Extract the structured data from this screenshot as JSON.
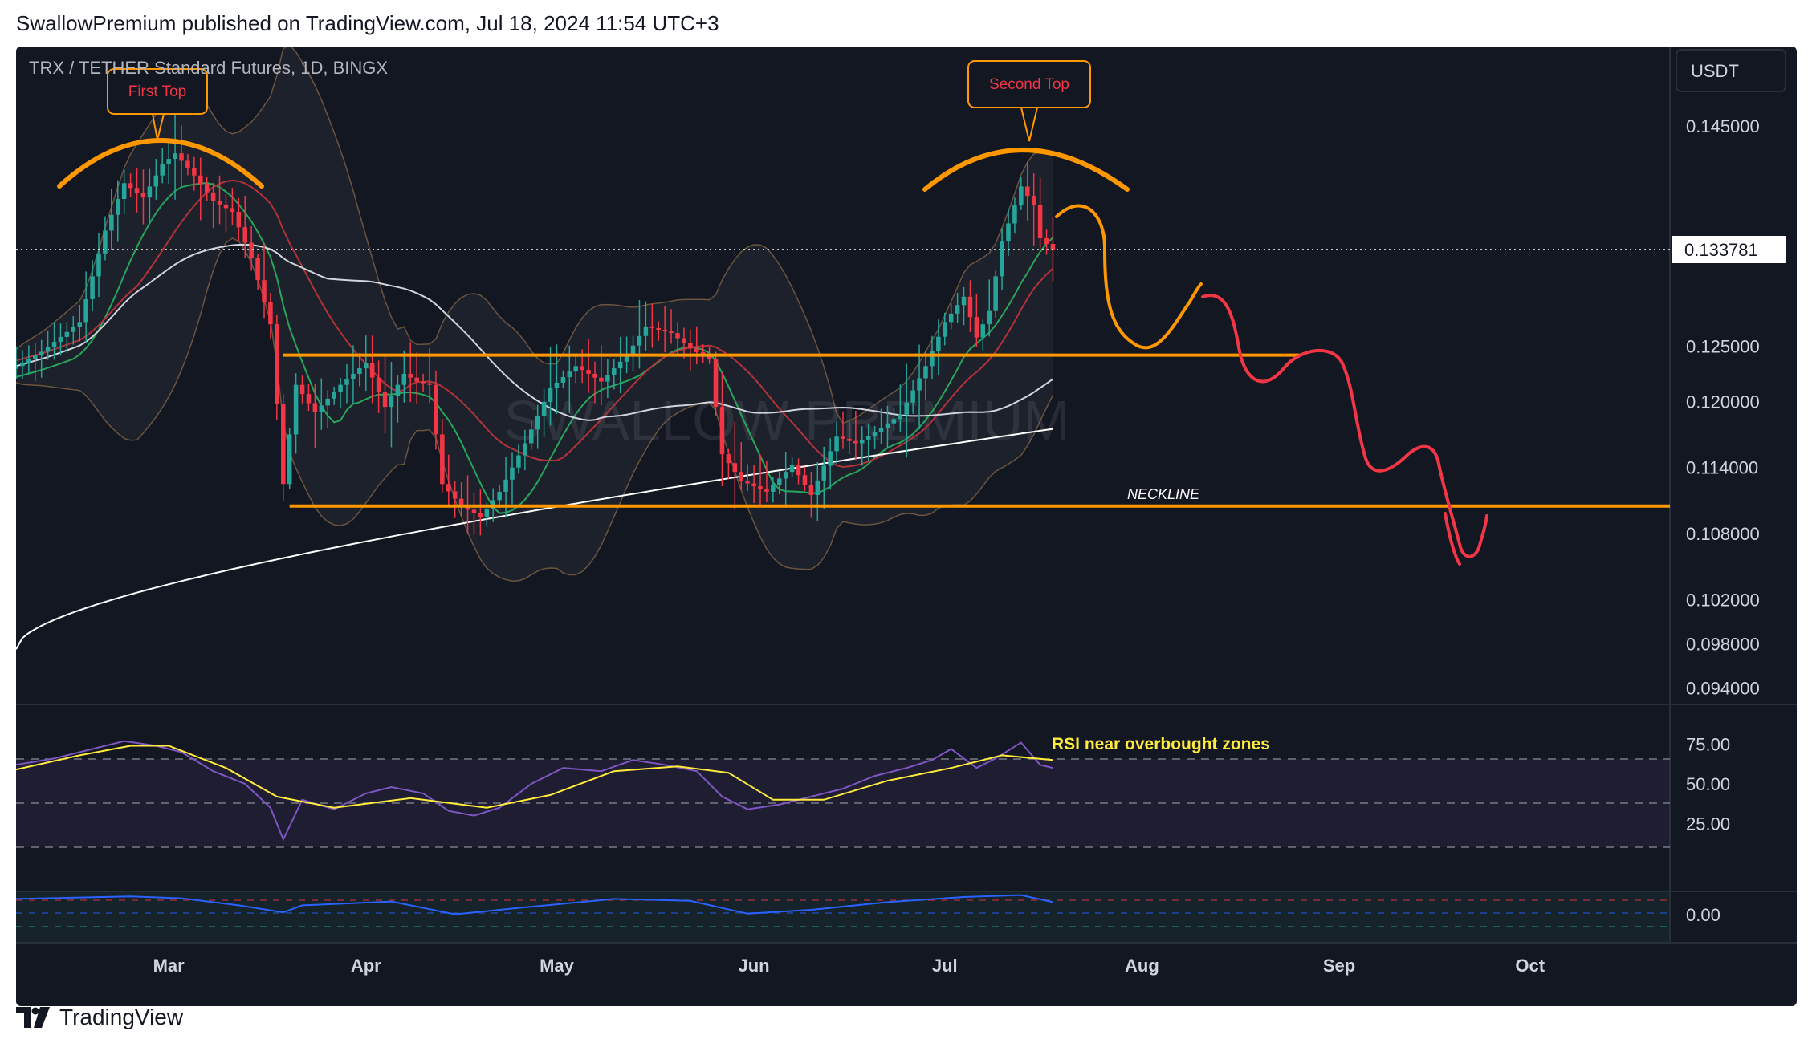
{
  "header": {
    "publish_line": "SwallowPremium published on TradingView.com, Jul 18, 2024 11:54 UTC+3"
  },
  "symbol_line": "TRX / TETHER Standard Futures, 1D, BINGX",
  "currency_button": "USDT",
  "watermark": "SWALLOW PREMIUM",
  "annotations": {
    "first_top": "First Top",
    "second_top": "Second Top",
    "neckline": "NECKLINE",
    "rsi_note": "RSI near overbought zones"
  },
  "footer": {
    "brand": "TradingView"
  },
  "colors": {
    "background": "#131722",
    "up": "#26a69a",
    "down": "#f23645",
    "annotation_orange": "#ff9800",
    "projection_red": "#f23645",
    "rsi_line": "#7e57c2",
    "rsi_ma": "#ffeb3b",
    "osc_line": "#2962ff"
  },
  "chart_data": [
    {
      "type": "candlestick",
      "title": "TRX / TETHER Standard Futures, 1D, BINGX",
      "x_ticks": [
        "Mar",
        "Apr",
        "May",
        "Jun",
        "Jul",
        "Aug",
        "Sep",
        "Oct"
      ],
      "x_tick_dates": [
        "2024-03-01",
        "2024-04-01",
        "2024-05-01",
        "2024-06-01",
        "2024-07-01",
        "2024-08-01",
        "2024-09-01",
        "2024-10-01"
      ],
      "x_range": [
        "2024-02-06",
        "2024-10-23"
      ],
      "y_ticks": [
        0.145,
        0.125,
        0.12,
        0.114,
        0.108,
        0.102,
        0.098,
        0.094
      ],
      "y_tick_labels": [
        "0.145000",
        "0.125000",
        "0.120000",
        "0.114000",
        "0.108000",
        "0.102000",
        "0.098000",
        "0.094000"
      ],
      "ylim": [
        0.0925,
        0.1522
      ],
      "current_price": 0.133781,
      "current_price_label": "0.133781",
      "support_resistance": [
        {
          "name": "resistance",
          "value": 0.1242,
          "from": "2024-03-19",
          "to": "2024-08-26"
        },
        {
          "name": "neckline",
          "value": 0.1105,
          "from": "2024-03-20",
          "to": "2024-10-23"
        }
      ],
      "anchors": [
        {
          "date": "2024-02-06",
          "close": 0.1232
        },
        {
          "date": "2024-02-10",
          "close": 0.1245
        },
        {
          "date": "2024-02-16",
          "close": 0.1272
        },
        {
          "date": "2024-02-20",
          "close": 0.1355
        },
        {
          "date": "2024-02-23",
          "close": 0.1398
        },
        {
          "date": "2024-02-26",
          "close": 0.1385
        },
        {
          "date": "2024-02-29",
          "close": 0.1415
        },
        {
          "date": "2024-03-02",
          "close": 0.1425
        },
        {
          "date": "2024-03-05",
          "close": 0.1405
        },
        {
          "date": "2024-03-08",
          "close": 0.1382
        },
        {
          "date": "2024-03-11",
          "close": 0.1372
        },
        {
          "date": "2024-03-14",
          "close": 0.133
        },
        {
          "date": "2024-03-17",
          "close": 0.127
        },
        {
          "date": "2024-03-19",
          "close": 0.1125
        },
        {
          "date": "2024-03-21",
          "close": 0.1215
        },
        {
          "date": "2024-03-24",
          "close": 0.119
        },
        {
          "date": "2024-03-28",
          "close": 0.1215
        },
        {
          "date": "2024-04-01",
          "close": 0.1235
        },
        {
          "date": "2024-04-04",
          "close": 0.1195
        },
        {
          "date": "2024-04-07",
          "close": 0.1225
        },
        {
          "date": "2024-04-09",
          "close": 0.1218
        },
        {
          "date": "2024-04-11",
          "close": 0.1215
        },
        {
          "date": "2024-04-13",
          "close": 0.1125
        },
        {
          "date": "2024-04-16",
          "close": 0.1105
        },
        {
          "date": "2024-04-19",
          "close": 0.1095
        },
        {
          "date": "2024-04-22",
          "close": 0.1118
        },
        {
          "date": "2024-04-26",
          "close": 0.1162
        },
        {
          "date": "2024-04-30",
          "close": 0.1212
        },
        {
          "date": "2024-05-04",
          "close": 0.1232
        },
        {
          "date": "2024-05-08",
          "close": 0.1218
        },
        {
          "date": "2024-05-12",
          "close": 0.1242
        },
        {
          "date": "2024-05-15",
          "close": 0.1268
        },
        {
          "date": "2024-05-19",
          "close": 0.1262
        },
        {
          "date": "2024-05-22",
          "close": 0.1248
        },
        {
          "date": "2024-05-25",
          "close": 0.1238
        },
        {
          "date": "2024-05-27",
          "close": 0.1152
        },
        {
          "date": "2024-05-30",
          "close": 0.1128
        },
        {
          "date": "2024-06-03",
          "close": 0.1118
        },
        {
          "date": "2024-06-07",
          "close": 0.1142
        },
        {
          "date": "2024-06-10",
          "close": 0.1115
        },
        {
          "date": "2024-06-14",
          "close": 0.1168
        },
        {
          "date": "2024-06-17",
          "close": 0.1162
        },
        {
          "date": "2024-06-20",
          "close": 0.1172
        },
        {
          "date": "2024-06-24",
          "close": 0.1188
        },
        {
          "date": "2024-06-28",
          "close": 0.1232
        },
        {
          "date": "2024-07-01",
          "close": 0.1272
        },
        {
          "date": "2024-07-04",
          "close": 0.1295
        },
        {
          "date": "2024-07-06",
          "close": 0.1258
        },
        {
          "date": "2024-07-08",
          "close": 0.1282
        },
        {
          "date": "2024-07-10",
          "close": 0.1345
        },
        {
          "date": "2024-07-12",
          "close": 0.1378
        },
        {
          "date": "2024-07-13",
          "close": 0.1395
        },
        {
          "date": "2024-07-15",
          "close": 0.1378
        },
        {
          "date": "2024-07-16",
          "close": 0.1348
        },
        {
          "date": "2024-07-18",
          "close": 0.133781
        }
      ]
    },
    {
      "type": "line",
      "title": "RSI",
      "y_ticks": [
        75,
        50,
        25
      ],
      "y_tick_labels": [
        "75.00",
        "50.00",
        "25.00"
      ],
      "ylim": [
        0,
        100
      ],
      "bands": [
        70,
        50,
        30
      ],
      "series": [
        {
          "values": [
            [
              "2024-02-06",
              62
            ],
            [
              "2024-02-12",
              66
            ],
            [
              "2024-02-18",
              72
            ],
            [
              "2024-02-23",
              77
            ],
            [
              "2024-02-28",
              74
            ],
            [
              "2024-03-03",
              70
            ],
            [
              "2024-03-08",
              58
            ],
            [
              "2024-03-13",
              50
            ],
            [
              "2024-03-17",
              35
            ],
            [
              "2024-03-19",
              15
            ],
            [
              "2024-03-22",
              40
            ],
            [
              "2024-03-27",
              34
            ],
            [
              "2024-04-01",
              44
            ],
            [
              "2024-04-05",
              48
            ],
            [
              "2024-04-10",
              44
            ],
            [
              "2024-04-14",
              33
            ],
            [
              "2024-04-18",
              30
            ],
            [
              "2024-04-22",
              35
            ],
            [
              "2024-04-27",
              50
            ],
            [
              "2024-05-02",
              60
            ],
            [
              "2024-05-08",
              58
            ],
            [
              "2024-05-13",
              65
            ],
            [
              "2024-05-18",
              62
            ],
            [
              "2024-05-23",
              58
            ],
            [
              "2024-05-27",
              42
            ],
            [
              "2024-05-31",
              34
            ],
            [
              "2024-06-05",
              37
            ],
            [
              "2024-06-10",
              42
            ],
            [
              "2024-06-15",
              47
            ],
            [
              "2024-06-20",
              55
            ],
            [
              "2024-06-25",
              60
            ],
            [
              "2024-06-29",
              65
            ],
            [
              "2024-07-02",
              72
            ],
            [
              "2024-07-06",
              60
            ],
            [
              "2024-07-09",
              66
            ],
            [
              "2024-07-13",
              76
            ],
            [
              "2024-07-16",
              62
            ],
            [
              "2024-07-18",
              60
            ]
          ]
        },
        {
          "values": [
            [
              "2024-02-06",
              59
            ],
            [
              "2024-02-16",
              68
            ],
            [
              "2024-02-24",
              74
            ],
            [
              "2024-03-01",
              74
            ],
            [
              "2024-03-10",
              60
            ],
            [
              "2024-03-18",
              42
            ],
            [
              "2024-03-27",
              35
            ],
            [
              "2024-04-08",
              41
            ],
            [
              "2024-04-20",
              35
            ],
            [
              "2024-04-30",
              43
            ],
            [
              "2024-05-10",
              58
            ],
            [
              "2024-05-20",
              61
            ],
            [
              "2024-05-28",
              57
            ],
            [
              "2024-06-04",
              40
            ],
            [
              "2024-06-12",
              40
            ],
            [
              "2024-06-22",
              52
            ],
            [
              "2024-07-02",
              60
            ],
            [
              "2024-07-10",
              68
            ],
            [
              "2024-07-18",
              65
            ]
          ]
        }
      ]
    },
    {
      "type": "line",
      "title": "Oscillator",
      "y_ticks": [
        0
      ],
      "y_tick_labels": [
        "0.00"
      ],
      "series": [
        {
          "values": [
            [
              "2024-02-06",
              2.2
            ],
            [
              "2024-02-24",
              2.6
            ],
            [
              "2024-03-03",
              2.3
            ],
            [
              "2024-03-12",
              1.2
            ],
            [
              "2024-03-19",
              0.1
            ],
            [
              "2024-03-22",
              1.2
            ],
            [
              "2024-04-05",
              1.8
            ],
            [
              "2024-04-15",
              -0.2
            ],
            [
              "2024-04-25",
              0.8
            ],
            [
              "2024-05-10",
              2.2
            ],
            [
              "2024-05-22",
              1.9
            ],
            [
              "2024-05-31",
              -0.1
            ],
            [
              "2024-06-10",
              0.5
            ],
            [
              "2024-06-22",
              1.7
            ],
            [
              "2024-07-04",
              2.5
            ],
            [
              "2024-07-13",
              2.8
            ],
            [
              "2024-07-18",
              1.7
            ]
          ]
        }
      ]
    }
  ]
}
